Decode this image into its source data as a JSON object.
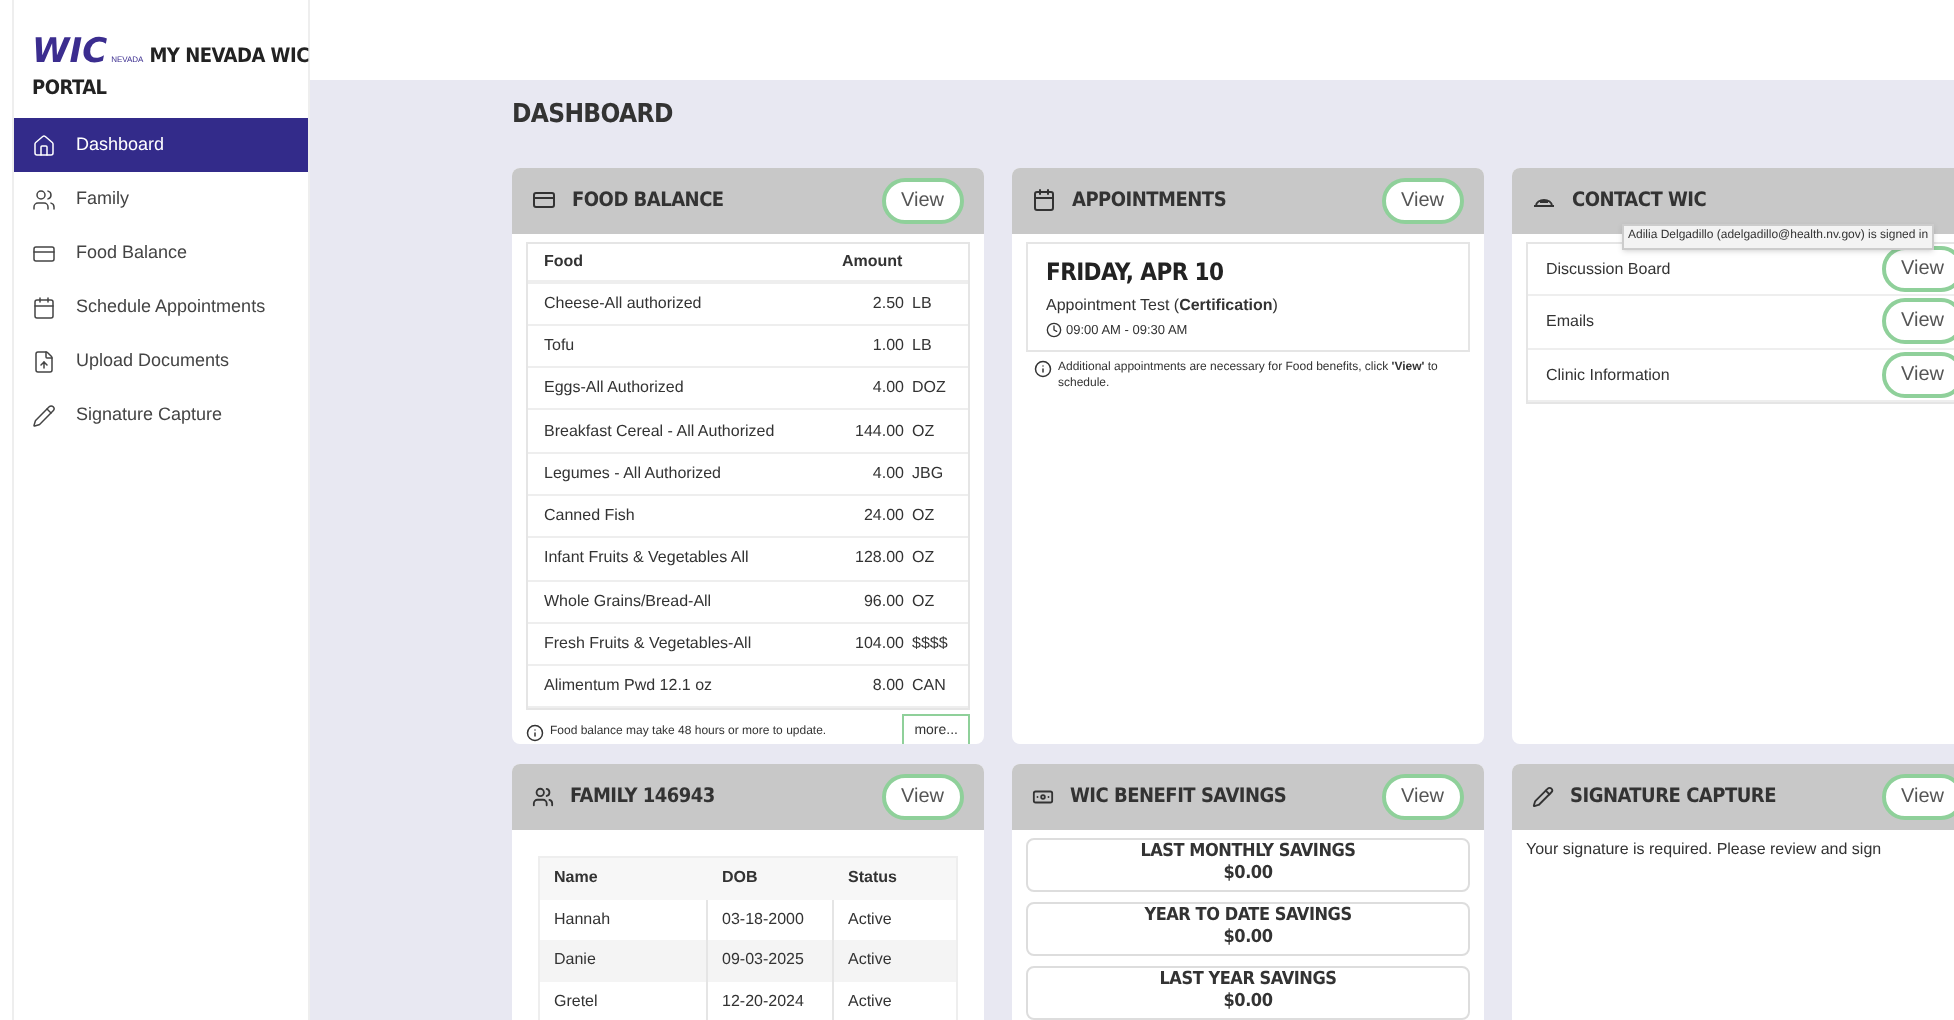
{
  "logo": {
    "mark": "WIC",
    "state": "NEVADA",
    "title_lines": [
      "MY NEVADA WIC",
      "PORTAL"
    ]
  },
  "sidebar": {
    "items": [
      {
        "label": "Dashboard",
        "selected": true
      },
      {
        "label": "Family",
        "selected": false
      },
      {
        "label": "Food Balance",
        "selected": false
      },
      {
        "label": "Schedule Appointments",
        "selected": false
      },
      {
        "label": "Upload Documents",
        "selected": false
      },
      {
        "label": "Signature Capture",
        "selected": false
      }
    ]
  },
  "page_title": "DASHBOARD",
  "food_balance": {
    "title": "FOOD BALANCE",
    "button": "View",
    "columns": [
      "Food",
      "Amount"
    ],
    "rows": [
      {
        "food": "Cheese-All authorized",
        "amount": "2.50",
        "unit": "LB"
      },
      {
        "food": "Tofu",
        "amount": "1.00",
        "unit": "LB"
      },
      {
        "food": "Eggs-All Authorized",
        "amount": "4.00",
        "unit": "DOZ"
      },
      {
        "food": "Breakfast Cereal - All Authorized",
        "amount": "144.00",
        "unit": "OZ"
      },
      {
        "food": "Legumes - All Authorized",
        "amount": "4.00",
        "unit": "JBG"
      },
      {
        "food": "Canned Fish",
        "amount": "24.00",
        "unit": "OZ"
      },
      {
        "food": "Infant Fruits & Vegetables All",
        "amount": "128.00",
        "unit": "OZ"
      },
      {
        "food": "Whole Grains/Bread-All",
        "amount": "96.00",
        "unit": "OZ"
      },
      {
        "food": "Fresh Fruits & Vegetables-All",
        "amount": "104.00",
        "unit": "$$$$"
      },
      {
        "food": "Alimentum Pwd 12.1 oz",
        "amount": "8.00",
        "unit": "CAN"
      }
    ],
    "note": "Food balance may take 48 hours or more to update.",
    "more": "more..."
  },
  "appointments": {
    "title": "APPOINTMENTS",
    "button": "View",
    "date": "FRIDAY, APR 10",
    "name": "Appointment Test (**Certification**)",
    "time": "09:00 AM - 09:30 AM",
    "note": "Additional appointments are necessary for Food benefits, click **'View'** to schedule."
  },
  "contact": {
    "title": "CONTACT WIC",
    "tooltip": "Adilia Delgadillo (adelgadillo@health.nv.gov) is signed in",
    "items": [
      {
        "label": "Discussion Board",
        "button": "View"
      },
      {
        "label": "Emails",
        "button": "View"
      },
      {
        "label": "Clinic Information",
        "button": "View"
      }
    ]
  },
  "family": {
    "title": "FAMILY 146943",
    "button": "View",
    "columns": [
      "Name",
      "DOB",
      "Status"
    ],
    "rows": [
      {
        "name": "Hannah",
        "dob": "03-18-2000",
        "status": "Active"
      },
      {
        "name": "Danie",
        "dob": "09-03-2025",
        "status": "Active"
      },
      {
        "name": "Gretel",
        "dob": "12-20-2024",
        "status": "Active"
      }
    ]
  },
  "savings": {
    "title": "WIC BENEFIT SAVINGS",
    "button": "View",
    "items": [
      {
        "label": "LAST MONTHLY SAVINGS",
        "value": "$0.00"
      },
      {
        "label": "YEAR TO DATE SAVINGS",
        "value": "$0.00"
      },
      {
        "label": "LAST YEAR SAVINGS",
        "value": "$0.00"
      }
    ]
  },
  "signature": {
    "title": "SIGNATURE CAPTURE",
    "button": "View",
    "text": "Your signature is required. Please review and sign"
  }
}
